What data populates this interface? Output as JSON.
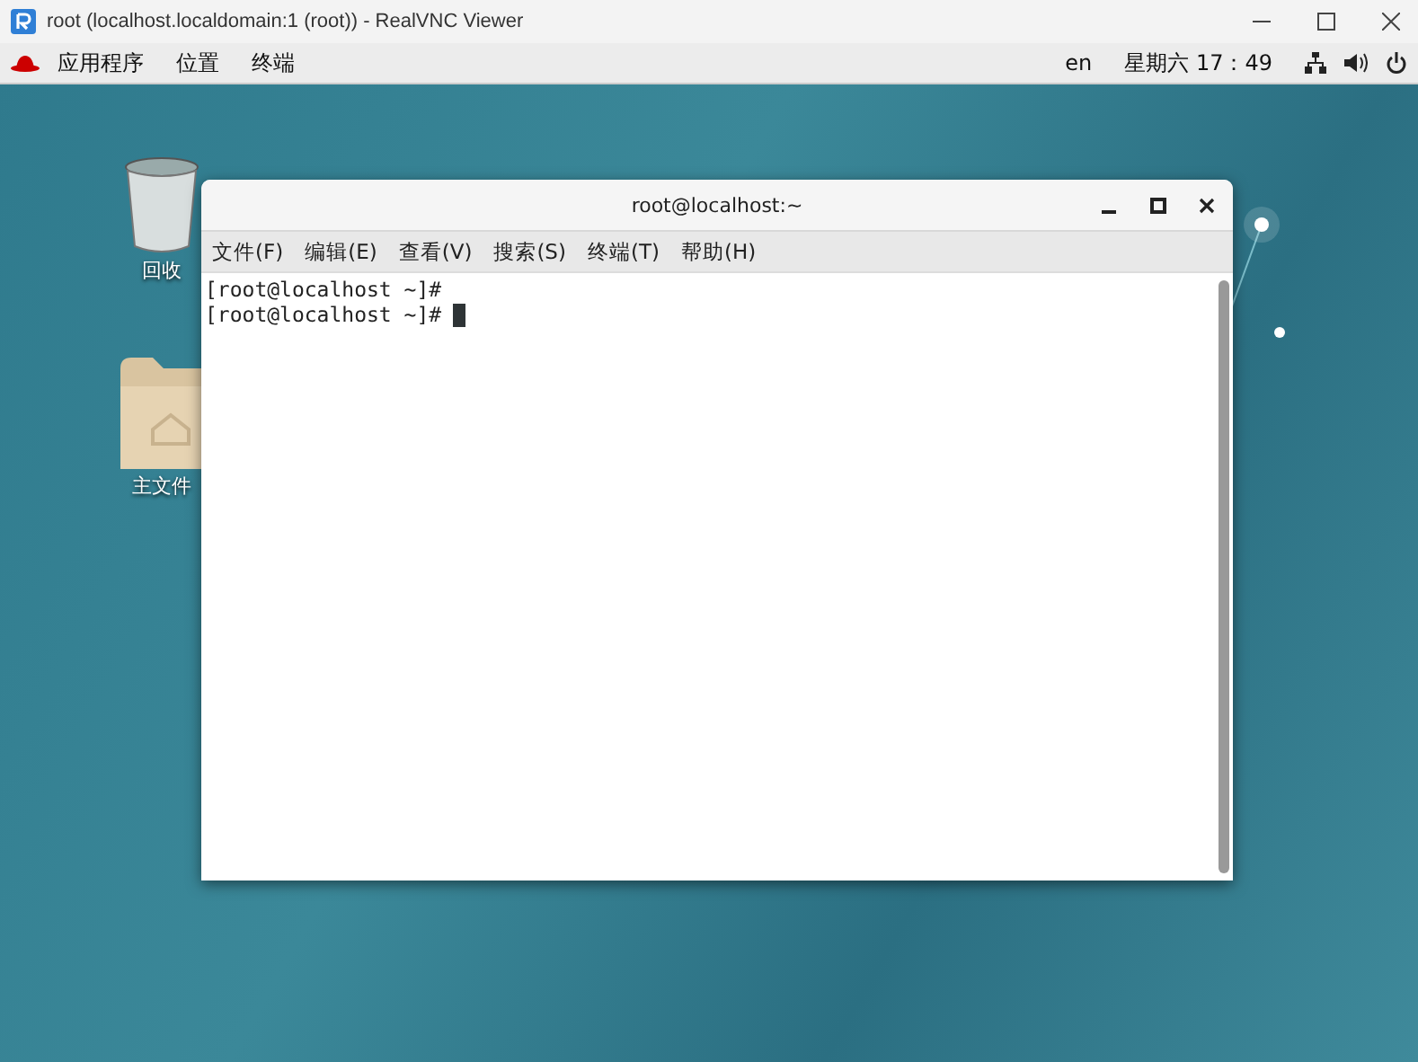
{
  "vnc_window": {
    "title": "root (localhost.localdomain:1 (root)) - RealVNC Viewer"
  },
  "top_bar": {
    "menus": [
      "应用程序",
      "位置",
      "终端"
    ],
    "language": "en",
    "clock": "星期六 17：49"
  },
  "desktop_icons": [
    {
      "kind": "trash",
      "label": "回收"
    },
    {
      "kind": "folder",
      "label": "主文件"
    }
  ],
  "terminal": {
    "title": "root@localhost:~",
    "menus": [
      "文件(F)",
      "编辑(E)",
      "查看(V)",
      "搜索(S)",
      "终端(T)",
      "帮助(H)"
    ],
    "lines": [
      "[root@localhost ~]# ",
      "[root@localhost ~]# "
    ]
  }
}
